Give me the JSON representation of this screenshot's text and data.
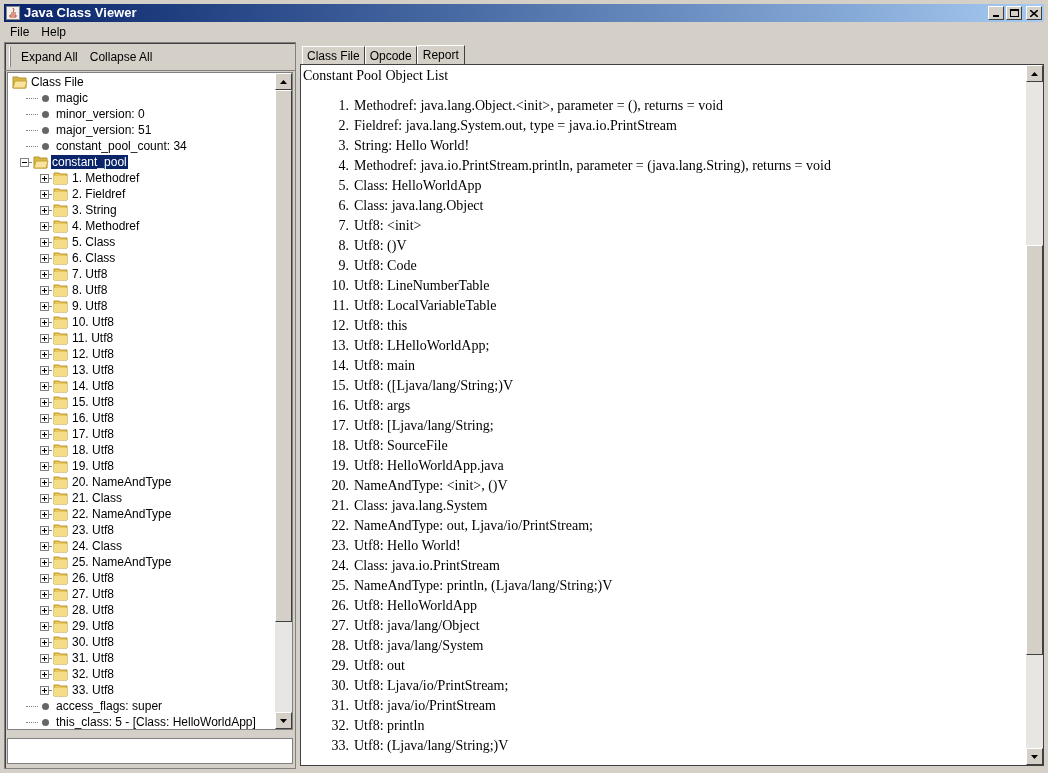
{
  "window": {
    "title": "Java Class Viewer"
  },
  "menu": [
    "File",
    "Help"
  ],
  "toolbar": [
    "Expand All",
    "Collapse All"
  ],
  "tree": {
    "label": "Class File",
    "kind": "folder",
    "expanded": true,
    "selected": false,
    "children": [
      {
        "label": "magic",
        "kind": "leaf",
        "selected": false
      },
      {
        "label": "minor_version: 0",
        "kind": "leaf",
        "selected": false
      },
      {
        "label": "major_version: 51",
        "kind": "leaf",
        "selected": false
      },
      {
        "label": "constant_pool_count: 34",
        "kind": "leaf",
        "selected": false
      },
      {
        "label": "constant_pool",
        "kind": "folder",
        "expanded": true,
        "selected": true,
        "children": [
          {
            "label": "1. Methodref",
            "kind": "folder",
            "expanded": false,
            "selected": false
          },
          {
            "label": "2. Fieldref",
            "kind": "folder",
            "expanded": false,
            "selected": false
          },
          {
            "label": "3. String",
            "kind": "folder",
            "expanded": false,
            "selected": false
          },
          {
            "label": "4. Methodref",
            "kind": "folder",
            "expanded": false,
            "selected": false
          },
          {
            "label": "5. Class",
            "kind": "folder",
            "expanded": false,
            "selected": false
          },
          {
            "label": "6. Class",
            "kind": "folder",
            "expanded": false,
            "selected": false
          },
          {
            "label": "7. Utf8",
            "kind": "folder",
            "expanded": false,
            "selected": false
          },
          {
            "label": "8. Utf8",
            "kind": "folder",
            "expanded": false,
            "selected": false
          },
          {
            "label": "9. Utf8",
            "kind": "folder",
            "expanded": false,
            "selected": false
          },
          {
            "label": "10. Utf8",
            "kind": "folder",
            "expanded": false,
            "selected": false
          },
          {
            "label": "11. Utf8",
            "kind": "folder",
            "expanded": false,
            "selected": false
          },
          {
            "label": "12. Utf8",
            "kind": "folder",
            "expanded": false,
            "selected": false
          },
          {
            "label": "13. Utf8",
            "kind": "folder",
            "expanded": false,
            "selected": false
          },
          {
            "label": "14. Utf8",
            "kind": "folder",
            "expanded": false,
            "selected": false
          },
          {
            "label": "15. Utf8",
            "kind": "folder",
            "expanded": false,
            "selected": false
          },
          {
            "label": "16. Utf8",
            "kind": "folder",
            "expanded": false,
            "selected": false
          },
          {
            "label": "17. Utf8",
            "kind": "folder",
            "expanded": false,
            "selected": false
          },
          {
            "label": "18. Utf8",
            "kind": "folder",
            "expanded": false,
            "selected": false
          },
          {
            "label": "19. Utf8",
            "kind": "folder",
            "expanded": false,
            "selected": false
          },
          {
            "label": "20. NameAndType",
            "kind": "folder",
            "expanded": false,
            "selected": false
          },
          {
            "label": "21. Class",
            "kind": "folder",
            "expanded": false,
            "selected": false
          },
          {
            "label": "22. NameAndType",
            "kind": "folder",
            "expanded": false,
            "selected": false
          },
          {
            "label": "23. Utf8",
            "kind": "folder",
            "expanded": false,
            "selected": false
          },
          {
            "label": "24. Class",
            "kind": "folder",
            "expanded": false,
            "selected": false
          },
          {
            "label": "25. NameAndType",
            "kind": "folder",
            "expanded": false,
            "selected": false
          },
          {
            "label": "26. Utf8",
            "kind": "folder",
            "expanded": false,
            "selected": false
          },
          {
            "label": "27. Utf8",
            "kind": "folder",
            "expanded": false,
            "selected": false
          },
          {
            "label": "28. Utf8",
            "kind": "folder",
            "expanded": false,
            "selected": false
          },
          {
            "label": "29. Utf8",
            "kind": "folder",
            "expanded": false,
            "selected": false
          },
          {
            "label": "30. Utf8",
            "kind": "folder",
            "expanded": false,
            "selected": false
          },
          {
            "label": "31. Utf8",
            "kind": "folder",
            "expanded": false,
            "selected": false
          },
          {
            "label": "32. Utf8",
            "kind": "folder",
            "expanded": false,
            "selected": false
          },
          {
            "label": "33. Utf8",
            "kind": "folder",
            "expanded": false,
            "selected": false
          }
        ]
      },
      {
        "label": "access_flags: super",
        "kind": "leaf",
        "selected": false
      },
      {
        "label": "this_class: 5 - [Class: HelloWorldApp]",
        "kind": "leaf",
        "selected": false
      }
    ]
  },
  "tabs": [
    {
      "label": "Class File",
      "selected": false
    },
    {
      "label": "Opcode",
      "selected": false
    },
    {
      "label": "Report",
      "selected": true
    }
  ],
  "report": {
    "heading": "Constant Pool Object List",
    "items": [
      {
        "number": "1.",
        "text": "Methodref: java.lang.Object.<init>, parameter = (), returns = void"
      },
      {
        "number": "2.",
        "text": "Fieldref: java.lang.System.out, type = java.io.PrintStream"
      },
      {
        "number": "3.",
        "text": "String: Hello World!"
      },
      {
        "number": "4.",
        "text": "Methodref: java.io.PrintStream.println, parameter = (java.lang.String), returns = void"
      },
      {
        "number": "5.",
        "text": "Class: HelloWorldApp"
      },
      {
        "number": "6.",
        "text": "Class: java.lang.Object"
      },
      {
        "number": "7.",
        "text": "Utf8: <init>"
      },
      {
        "number": "8.",
        "text": "Utf8: ()V"
      },
      {
        "number": "9.",
        "text": "Utf8: Code"
      },
      {
        "number": "10.",
        "text": "Utf8: LineNumberTable"
      },
      {
        "number": "11.",
        "text": "Utf8: LocalVariableTable"
      },
      {
        "number": "12.",
        "text": "Utf8: this"
      },
      {
        "number": "13.",
        "text": "Utf8: LHelloWorldApp;"
      },
      {
        "number": "14.",
        "text": "Utf8: main"
      },
      {
        "number": "15.",
        "text": "Utf8: ([Ljava/lang/String;)V"
      },
      {
        "number": "16.",
        "text": "Utf8: args"
      },
      {
        "number": "17.",
        "text": "Utf8: [Ljava/lang/String;"
      },
      {
        "number": "18.",
        "text": "Utf8: SourceFile"
      },
      {
        "number": "19.",
        "text": "Utf8: HelloWorldApp.java"
      },
      {
        "number": "20.",
        "text": "NameAndType: <init>, ()V"
      },
      {
        "number": "21.",
        "text": "Class: java.lang.System"
      },
      {
        "number": "22.",
        "text": "NameAndType: out, Ljava/io/PrintStream;"
      },
      {
        "number": "23.",
        "text": "Utf8: Hello World!"
      },
      {
        "number": "24.",
        "text": "Class: java.io.PrintStream"
      },
      {
        "number": "25.",
        "text": "NameAndType: println, (Ljava/lang/String;)V"
      },
      {
        "number": "26.",
        "text": "Utf8: HelloWorldApp"
      },
      {
        "number": "27.",
        "text": "Utf8: java/lang/Object"
      },
      {
        "number": "28.",
        "text": "Utf8: java/lang/System"
      },
      {
        "number": "29.",
        "text": "Utf8: out"
      },
      {
        "number": "30.",
        "text": "Utf8: Ljava/io/PrintStream;"
      },
      {
        "number": "31.",
        "text": "Utf8: java/io/PrintStream"
      },
      {
        "number": "32.",
        "text": "Utf8: println"
      },
      {
        "number": "33.",
        "text": "Utf8: (Ljava/lang/String;)V"
      }
    ]
  }
}
